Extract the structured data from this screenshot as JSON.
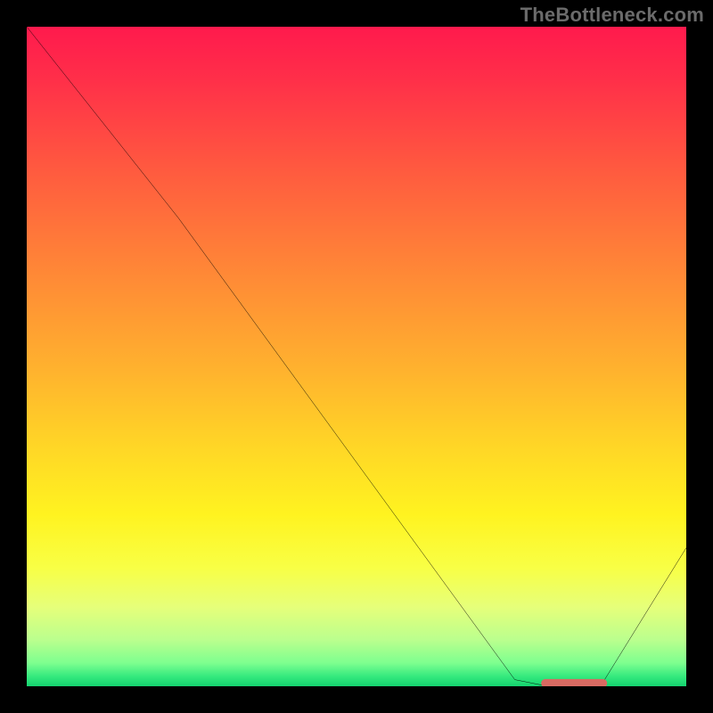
{
  "watermark": "TheBottleneck.com",
  "chart_data": {
    "type": "line",
    "title": "",
    "xlabel": "",
    "ylabel": "",
    "xlim": [
      0,
      100
    ],
    "ylim": [
      0,
      100
    ],
    "grid": false,
    "legend": false,
    "series": [
      {
        "name": "curve",
        "color": "#000000",
        "x": [
          0,
          23,
          74,
          79,
          87,
          100
        ],
        "y": [
          100,
          71,
          1,
          0,
          0,
          21
        ]
      }
    ],
    "marker": {
      "name": "optimal-range",
      "color": "#d86a62",
      "x_start": 78,
      "x_end": 88,
      "y": 0,
      "thickness_pct": 1.3
    },
    "gradient_stops": [
      {
        "pos": 0,
        "color": "#ff1a4d"
      },
      {
        "pos": 8,
        "color": "#ff2f49"
      },
      {
        "pos": 22,
        "color": "#ff5b3f"
      },
      {
        "pos": 38,
        "color": "#ff8a36"
      },
      {
        "pos": 52,
        "color": "#ffb22e"
      },
      {
        "pos": 64,
        "color": "#ffd726"
      },
      {
        "pos": 74,
        "color": "#fff320"
      },
      {
        "pos": 82,
        "color": "#f8ff45"
      },
      {
        "pos": 88,
        "color": "#e6ff7a"
      },
      {
        "pos": 93,
        "color": "#baff8e"
      },
      {
        "pos": 96.5,
        "color": "#7dff8f"
      },
      {
        "pos": 98.5,
        "color": "#35e97e"
      },
      {
        "pos": 100,
        "color": "#14d36f"
      }
    ]
  }
}
